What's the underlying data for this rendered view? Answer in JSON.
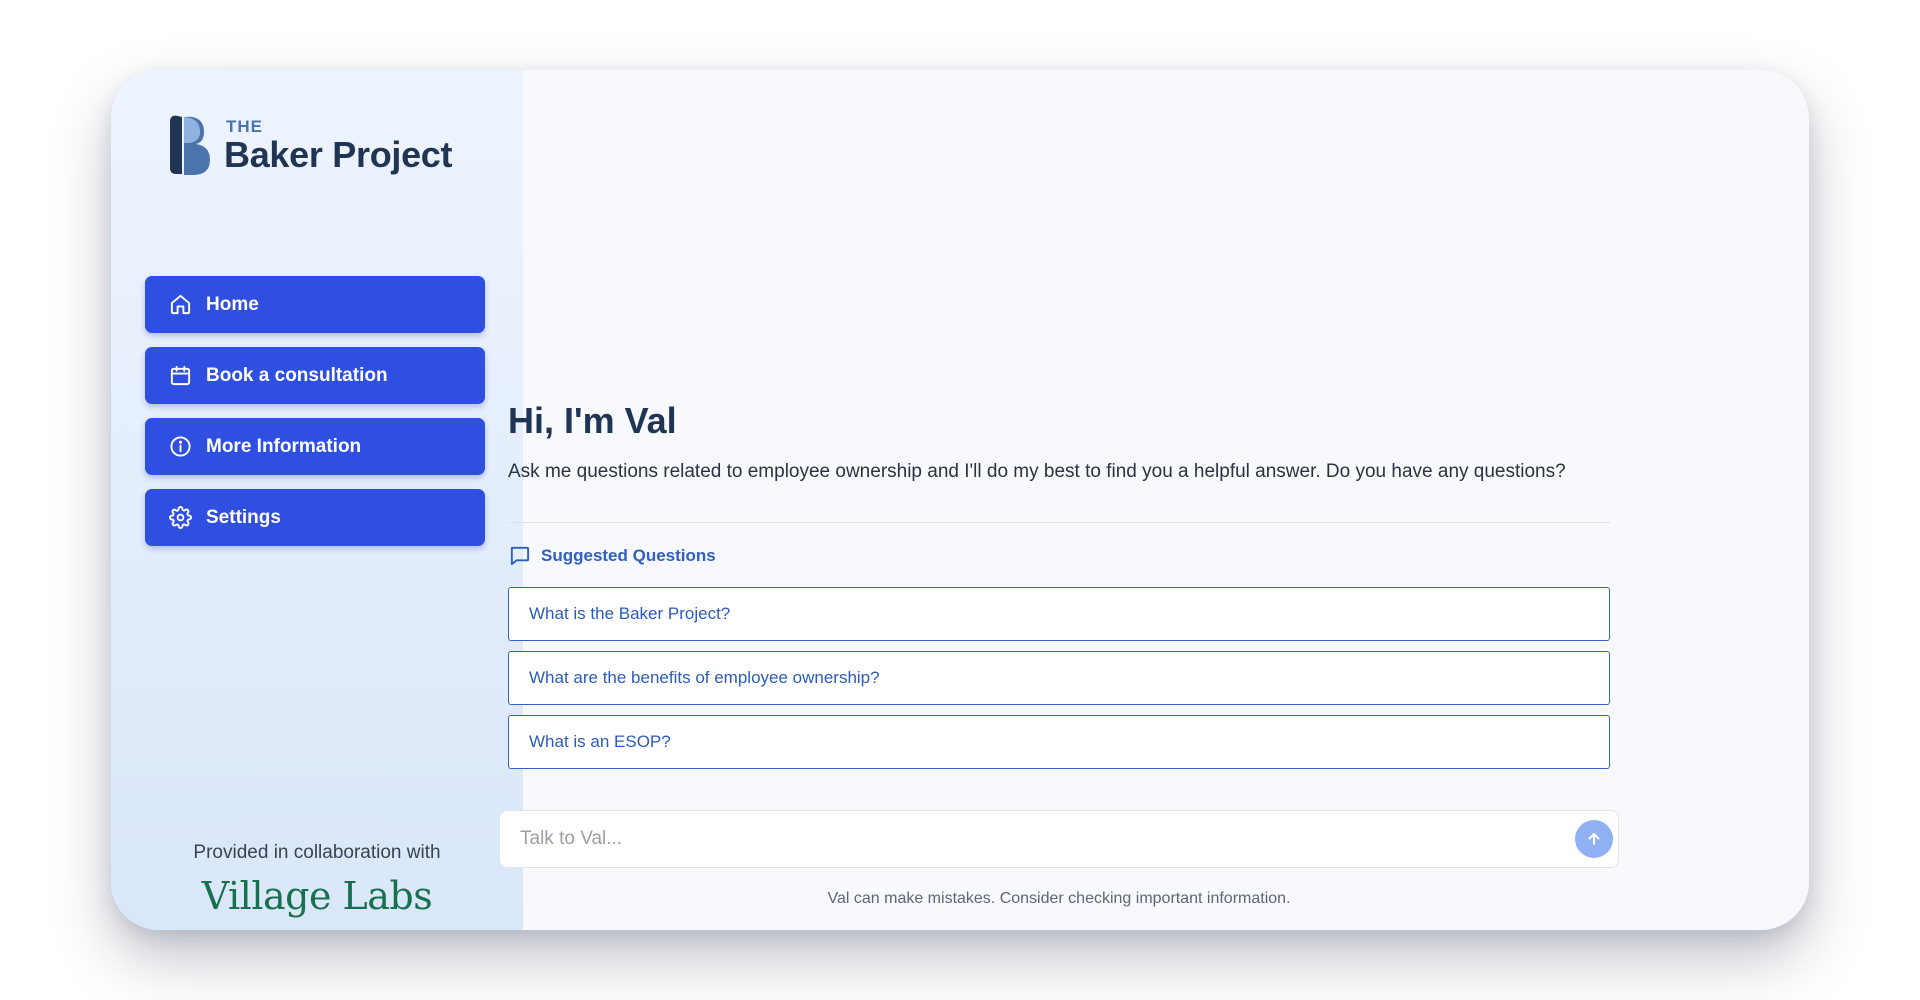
{
  "logo": {
    "prefix": "THE",
    "name": "Baker Project"
  },
  "nav": {
    "items": [
      {
        "label": "Home",
        "icon": "home-icon"
      },
      {
        "label": "Book a consultation",
        "icon": "calendar-icon"
      },
      {
        "label": "More Information",
        "icon": "info-icon"
      },
      {
        "label": "Settings",
        "icon": "gear-icon"
      }
    ]
  },
  "collaboration": {
    "text": "Provided in collaboration with",
    "brand": "Village Labs"
  },
  "main": {
    "greeting": "Hi, I'm Val",
    "intro": "Ask me questions related to employee ownership and I'll do my best to find you a helpful answer. Do you have any questions?",
    "suggested_heading": "Suggested Questions",
    "questions": [
      "What is the Baker Project?",
      "What are the benefits of employee ownership?",
      "What is an ESOP?"
    ]
  },
  "chat": {
    "placeholder": "Talk to Val...",
    "disclaimer": "Val can make mistakes. Consider checking important information."
  },
  "colors": {
    "nav_button": "#2f4fe0",
    "brand_dark": "#1f3553",
    "link_blue": "#2d5bbd",
    "collab_green": "#17704e",
    "send_button": "#8fb0f2"
  }
}
